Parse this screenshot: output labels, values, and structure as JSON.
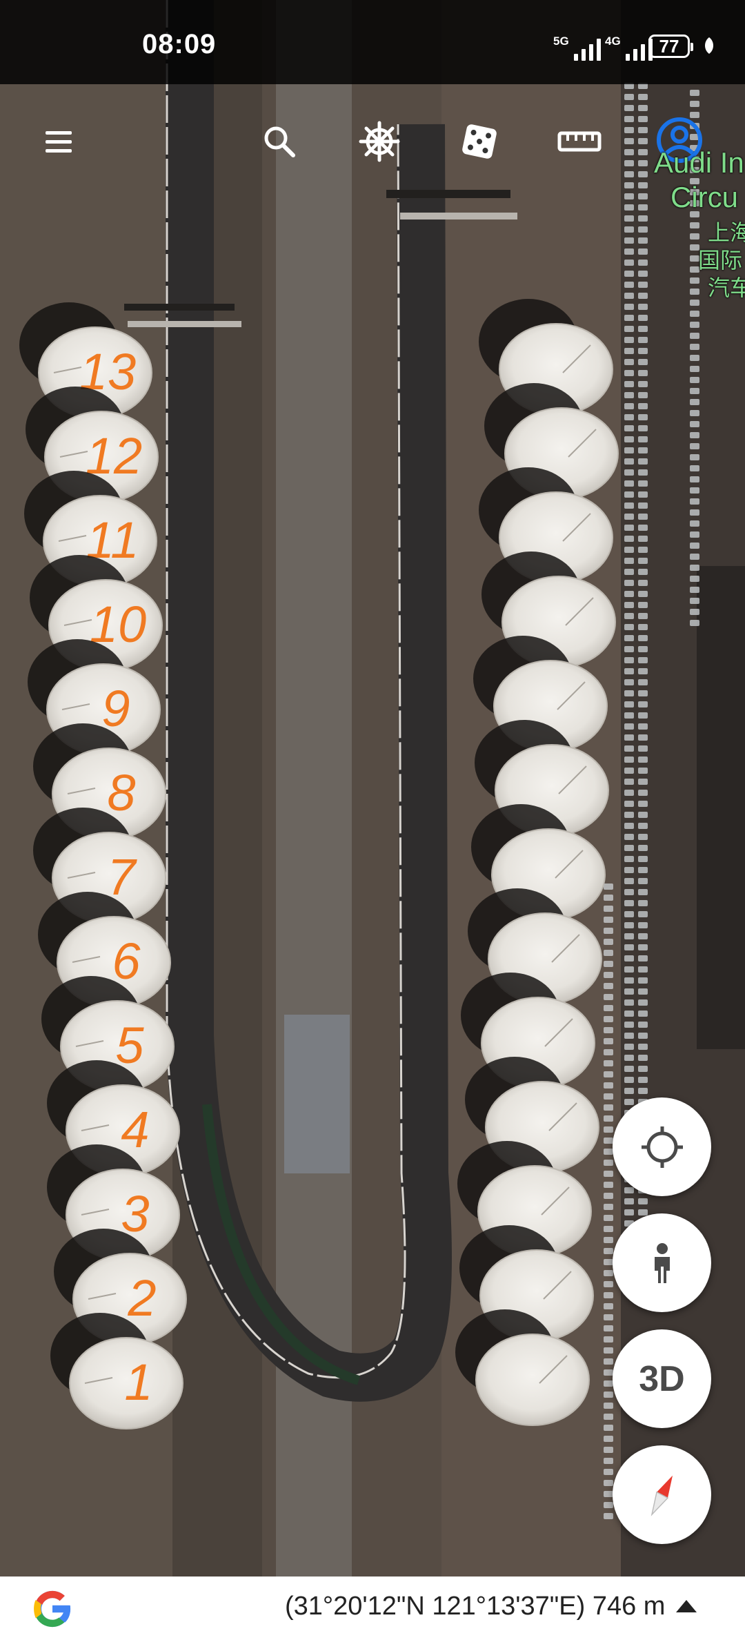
{
  "status_bar": {
    "time": "08:09",
    "signal_1_label": "5G",
    "signal_2_label": "4G",
    "battery_level": "77"
  },
  "toolbar": {
    "icons": [
      "menu-icon",
      "search-icon",
      "ship-wheel-icon",
      "dice-icon",
      "ruler-icon",
      "account-icon"
    ]
  },
  "map": {
    "place_label_line1": "Audi In",
    "place_label_line2": "Circu",
    "place_label_cn1": "上海",
    "place_label_cn2": "国际",
    "place_label_cn3": "汽车",
    "left_pit_numbers": [
      "13",
      "12",
      "11",
      "10",
      "9",
      "8",
      "7",
      "6",
      "5",
      "4",
      "3",
      "2",
      "1"
    ],
    "right_pit_count": 13
  },
  "controls": {
    "locate_icon": "crosshair-icon",
    "street_view_icon": "pegman-icon",
    "three_d_label": "3D",
    "compass_icon": "compass-icon"
  },
  "bottom_bar": {
    "coordinates": "(31°20'12\"N 121°13'37\"E) 746 m"
  },
  "colors": {
    "annotation": "#f07a22",
    "place_label": "#7fdc8a",
    "account_ring": "#1a73e8"
  }
}
